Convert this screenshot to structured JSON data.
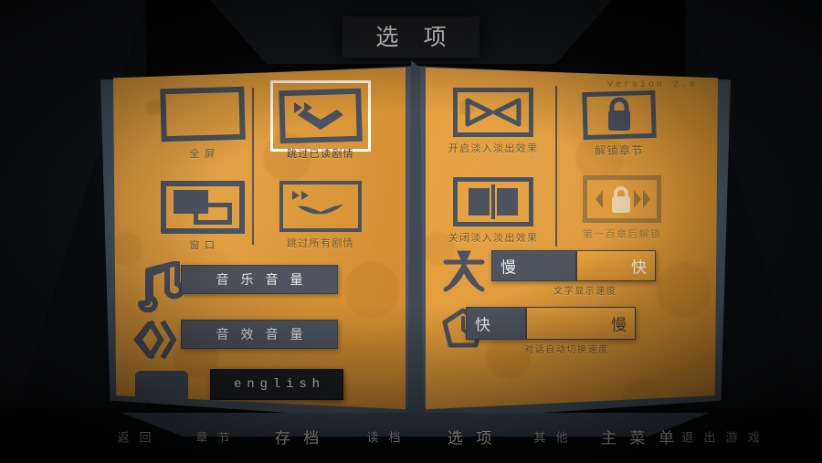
{
  "window": {
    "title": "选 项",
    "version": "Version 2.0"
  },
  "left_page": {
    "display_options": [
      {
        "label": "全 屏",
        "icon": "fullscreen-icon",
        "selected": false
      },
      {
        "label": "窗 口",
        "icon": "window-mode-icon",
        "selected": false
      }
    ],
    "skip_options": [
      {
        "label": "跳过已读剧情",
        "icon": "skip-read-icon",
        "selected": true
      },
      {
        "label": "跳过所有剧情",
        "icon": "skip-all-icon",
        "selected": false
      }
    ],
    "buttons": [
      {
        "label": "音 乐 音 量",
        "icon": "music-note-icon"
      },
      {
        "label": "音 效 音 量",
        "icon": "sound-wave-icon"
      }
    ],
    "language": {
      "label": "english",
      "icon": "speech-bubble-icon"
    }
  },
  "right_page": {
    "fade_options": [
      {
        "label": "开启淡入淡出效果",
        "icon": "fade-on-icon",
        "selected": false
      },
      {
        "label": "关闭淡入淡出效果",
        "icon": "fade-off-icon",
        "selected": false
      }
    ],
    "unlock_options": [
      {
        "label": "解锁章节",
        "icon": "lock-icon",
        "selected": false,
        "locked": false
      },
      {
        "label": "第一百章后解锁",
        "icon": "locked-skip-icon",
        "selected": false,
        "locked": true
      }
    ],
    "sliders": [
      {
        "caption": "文字显示速度",
        "low": "慢",
        "high": "快",
        "value": 52,
        "icon": "text-char-icon"
      },
      {
        "caption": "对话自动切换速度",
        "low": "快",
        "high": "慢",
        "value": 36,
        "icon": "clock-icon"
      }
    ]
  },
  "nav": {
    "items": [
      {
        "label": "返 回",
        "active": false
      },
      {
        "label": "章 节",
        "active": false
      },
      {
        "label": "存 档",
        "active": true
      },
      {
        "label": "读 档",
        "active": false
      },
      {
        "label": "选 项",
        "active": true
      },
      {
        "label": "其 他",
        "active": false
      },
      {
        "label": "主 菜 单",
        "active": true
      },
      {
        "label": "退 出 游 戏",
        "active": false
      }
    ]
  },
  "colors": {
    "page": "#e09a38",
    "ink": "#4b5360",
    "backing": "#4a5663",
    "selection": "#ffffff",
    "label": "#6c5a33"
  }
}
